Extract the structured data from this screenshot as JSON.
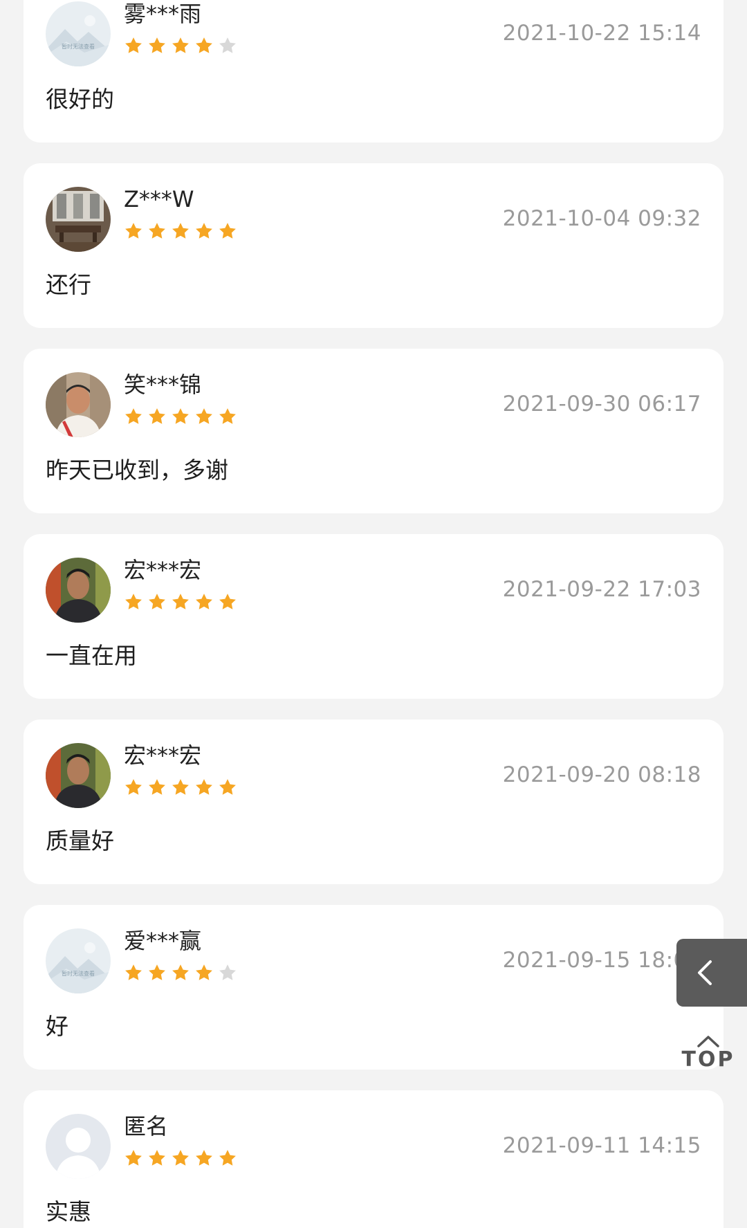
{
  "colors": {
    "star_filled": "#f6a623",
    "star_empty": "#d8d8d8",
    "background": "#f3f3f3",
    "card": "#ffffff",
    "timestamp": "#9a9a9a"
  },
  "reviews": [
    {
      "name": "雾***雨",
      "rating": 4,
      "time": "2021-10-22 15:14",
      "content": "很好的",
      "avatar": "placeholder-image-icon",
      "avatar_text": "暂时无法查看"
    },
    {
      "name": "Z***W",
      "rating": 5,
      "time": "2021-10-04 09:32",
      "content": "还行",
      "avatar": "room-photo"
    },
    {
      "name": "笑***锦",
      "rating": 5,
      "time": "2021-09-30 06:17",
      "content": "昨天已收到，多谢",
      "avatar": "person-photo"
    },
    {
      "name": "宏***宏",
      "rating": 5,
      "time": "2021-09-22 17:03",
      "content": "一直在用",
      "avatar": "person-photo"
    },
    {
      "name": "宏***宏",
      "rating": 5,
      "time": "2021-09-20 08:18",
      "content": "质量好",
      "avatar": "person-photo"
    },
    {
      "name": "爱***赢",
      "rating": 4,
      "time": "2021-09-15 18:07",
      "content": "好",
      "avatar": "placeholder-image-icon",
      "avatar_text": "暂时无法查看"
    },
    {
      "name": "匿名",
      "rating": 5,
      "time": "2021-09-11 14:15",
      "content": "实惠",
      "avatar": "default-user-icon"
    }
  ],
  "floating": {
    "back_icon": "chevron-left-icon",
    "top_icon": "chevron-up-icon",
    "top_label": "TOP"
  }
}
